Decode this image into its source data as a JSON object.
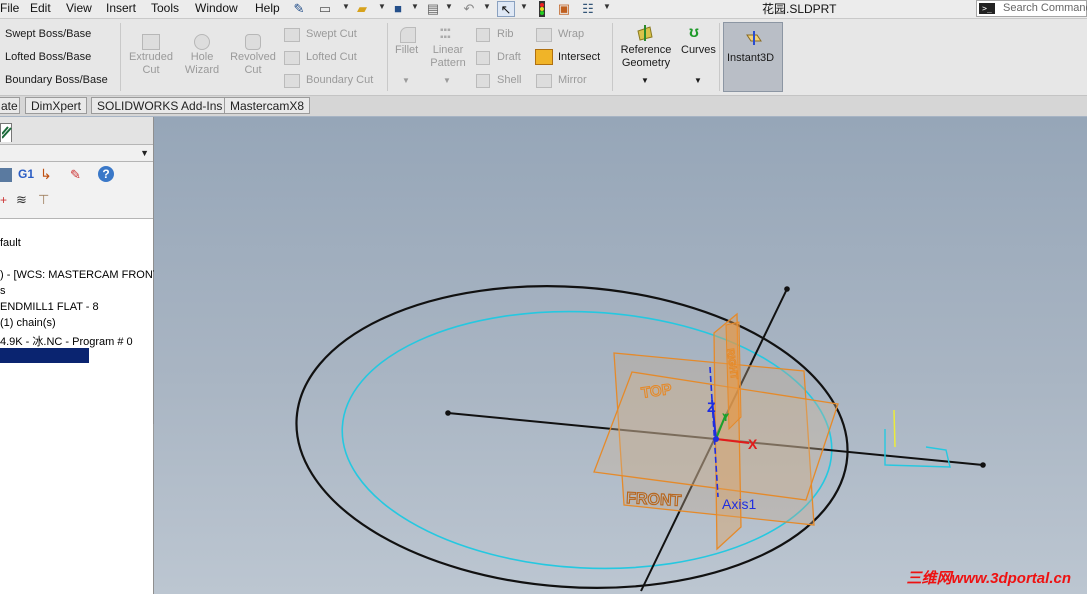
{
  "menu": {
    "items": [
      "File",
      "Edit",
      "View",
      "Insert",
      "Tools",
      "Window",
      "Help"
    ]
  },
  "window": {
    "title": "花园.SLDPRT",
    "search_placeholder": "Search Commands"
  },
  "ribbon": {
    "swept_boss": "Swept Boss/Base",
    "lofted_boss": "Lofted Boss/Base",
    "boundary_boss": "Boundary Boss/Base",
    "extruded_cut": [
      "Extruded",
      "Cut"
    ],
    "hole_wizard": [
      "Hole",
      "Wizard"
    ],
    "revolved_cut": [
      "Revolved",
      "Cut"
    ],
    "swept_cut": "Swept Cut",
    "lofted_cut": "Lofted Cut",
    "boundary_cut": "Boundary Cut",
    "fillet": "Fillet",
    "linear_pattern": [
      "Linear",
      "Pattern"
    ],
    "rib": "Rib",
    "draft": "Draft",
    "shell": "Shell",
    "wrap": "Wrap",
    "intersect": "Intersect",
    "mirror": "Mirror",
    "reference_geometry": [
      "Reference",
      "Geometry"
    ],
    "curves": "Curves",
    "instant3d": "Instant3D"
  },
  "tabs": [
    "ate",
    "DimXpert",
    "SOLIDWORKS Add-Ins",
    "MastercamX8"
  ],
  "left_panel": {
    "g1_label": "G1",
    "tree": [
      "fault",
      ") - [WCS: MASTERCAM FRONT]",
      "s",
      " ENDMILL1 FLAT - 8",
      " (1) chain(s)",
      "4.9K - 冰.NC - Program # 0"
    ]
  },
  "viewport": {
    "plane_top": "TOP",
    "plane_front": "FRONT",
    "plane_right": "RIGHT",
    "axis_label": "Axis1",
    "triad_x": "X",
    "triad_y": "Y",
    "triad_z": "Z",
    "watermark": "三维网www.3dportal.cn"
  },
  "colors": {
    "plane_orange": "#e58a2a",
    "circle_cyan": "#25c8e0",
    "sketch_black": "#111111",
    "axis_blue": "#1f2ee0",
    "triad_x_red": "#e21b1b",
    "triad_y_green": "#1aa12c",
    "selection_navy": "#0a2470",
    "watermark_red": "#e11111"
  },
  "icons": [
    "pin-icon",
    "new-doc-icon",
    "open-icon",
    "save-icon",
    "print-icon",
    "undo-icon",
    "select-arrow-icon",
    "traffic-light-icon",
    "file-props-icon",
    "options-icon",
    "terminal-icon",
    "zoom-fit-icon",
    "zoom-area-icon",
    "previous-view-icon",
    "section-view-icon",
    "view-orientation-icon",
    "display-style-icon",
    "hide-show-icon",
    "appearance-icon",
    "scene-icon",
    "view-settings-icon",
    "help-icon"
  ]
}
